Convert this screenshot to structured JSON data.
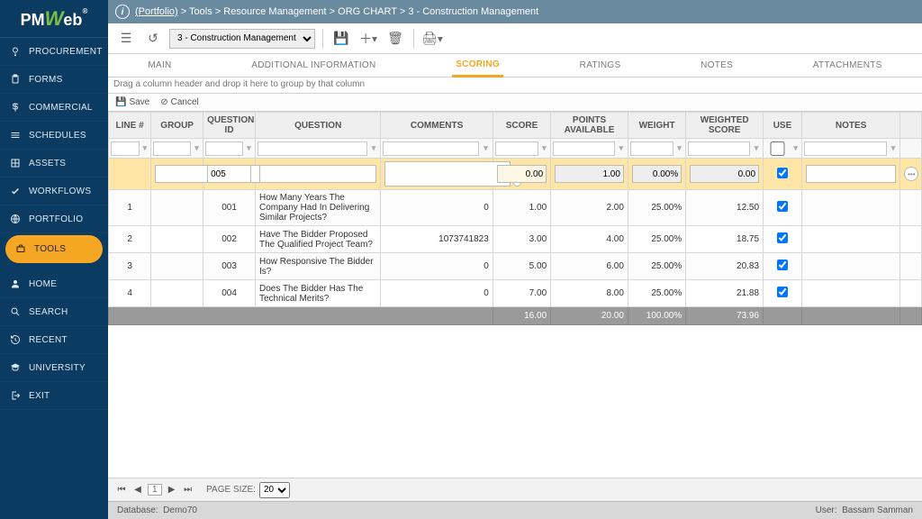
{
  "logo": {
    "p": "P",
    "m": "M",
    "w": "W",
    "eb": "eb",
    "reg": "®"
  },
  "sidebar": {
    "items": [
      {
        "label": "PROCUREMENT",
        "icon": "bulb"
      },
      {
        "label": "FORMS",
        "icon": "clipboard"
      },
      {
        "label": "COMMERCIAL",
        "icon": "dollar"
      },
      {
        "label": "SCHEDULES",
        "icon": "bars"
      },
      {
        "label": "ASSETS",
        "icon": "grid"
      },
      {
        "label": "WORKFLOWS",
        "icon": "check"
      },
      {
        "label": "PORTFOLIO",
        "icon": "globe"
      },
      {
        "label": "TOOLS",
        "icon": "briefcase",
        "active": true
      }
    ],
    "lower": [
      {
        "label": "HOME",
        "icon": "avatar"
      },
      {
        "label": "SEARCH",
        "icon": "search"
      },
      {
        "label": "RECENT",
        "icon": "history"
      },
      {
        "label": "UNIVERSITY",
        "icon": "grad"
      },
      {
        "label": "EXIT",
        "icon": "exit"
      }
    ]
  },
  "breadcrumb": [
    "(Portfolio)",
    "Tools",
    "Resource Management",
    "ORG CHART",
    "3 - Construction Management"
  ],
  "toolbar": {
    "select_value": "3 - Construction Management"
  },
  "tabs": [
    "MAIN",
    "ADDITIONAL INFORMATION",
    "SCORING",
    "RATINGS",
    "NOTES",
    "ATTACHMENTS"
  ],
  "active_tab": 2,
  "group_hint": "Drag a column header and drop it here to group by that column",
  "actions": {
    "save": "Save",
    "cancel": "Cancel"
  },
  "columns": [
    "LINE #",
    "GROUP",
    "QUESTION ID",
    "QUESTION",
    "COMMENTS",
    "SCORE",
    "POINTS AVAILABLE",
    "WEIGHT",
    "WEIGHTED SCORE",
    "USE",
    "NOTES"
  ],
  "newrow": {
    "qid": "005",
    "score": "0.00",
    "points": "1.00",
    "weight": "0.00%",
    "wscore": "0.00",
    "use": true
  },
  "rows": [
    {
      "line": "1",
      "qid": "001",
      "question": "How Many Years The Company Had In Delivering Similar Projects?",
      "comments": "0",
      "score": "1.00",
      "points": "2.00",
      "weight": "25.00%",
      "wscore": "12.50",
      "use": true
    },
    {
      "line": "2",
      "qid": "002",
      "question": "Have The Bidder Proposed The Qualified Project Team?",
      "comments": "1073741823",
      "score": "3.00",
      "points": "4.00",
      "weight": "25.00%",
      "wscore": "18.75",
      "use": true
    },
    {
      "line": "3",
      "qid": "003",
      "question": "How Responsive The Bidder Is?",
      "comments": "0",
      "score": "5.00",
      "points": "6.00",
      "weight": "25.00%",
      "wscore": "20.83",
      "use": true
    },
    {
      "line": "4",
      "qid": "004",
      "question": "Does The Bidder Has The Technical Merits?",
      "comments": "0",
      "score": "7.00",
      "points": "8.00",
      "weight": "25.00%",
      "wscore": "21.88",
      "use": true
    }
  ],
  "totals": {
    "score": "16.00",
    "points": "20.00",
    "weight": "100.00%",
    "wscore": "73.96"
  },
  "pager": {
    "page_size_label": "PAGE SIZE:",
    "page_size": "20",
    "current": "1"
  },
  "footer": {
    "db_label": "Database:",
    "db": "Demo70",
    "user_label": "User:",
    "user": "Bassam Samman"
  }
}
